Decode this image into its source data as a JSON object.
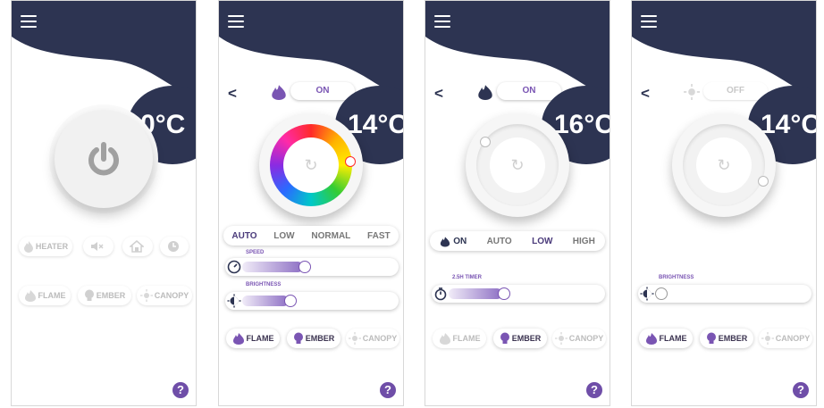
{
  "colors": {
    "navy": "#2d3452",
    "accent": "#7a55b3",
    "muted": "#bcbcbc"
  },
  "screen1": {
    "temperature": "0°C",
    "icons": [
      "heater-icon",
      "mute-icon",
      "home-icon",
      "clock-icon"
    ],
    "heater_label": "HEATER",
    "flame_label": "FLAME",
    "ember_label": "EMBER",
    "canopy_label": "CANOPY"
  },
  "screen2": {
    "temperature": "14°C",
    "toggle": "ON",
    "modes": [
      "AUTO",
      "LOW",
      "NORMAL",
      "FAST"
    ],
    "selected_mode": "AUTO",
    "speed_label": "SPEED",
    "speed_level": 0.5,
    "brightness_label": "BRIGHTNESS",
    "brightness_level": 0.4,
    "flame_label": "FLAME",
    "ember_label": "EMBER",
    "canopy_label": "CANOPY"
  },
  "screen3": {
    "temperature": "16°C",
    "on_label": "ON",
    "toggle": "ON",
    "modes": [
      "AUTO",
      "LOW",
      "HIGH"
    ],
    "selected_mode": "LOW",
    "timer_label": "2.5H TIMER",
    "timer_level": 0.35,
    "flame_label": "FLAME",
    "ember_label": "EMBER",
    "canopy_label": "CANOPY"
  },
  "screen4": {
    "temperature": "14°C",
    "toggle": "OFF",
    "brightness_label": "BRIGHTNESS",
    "brightness_level": 0.0,
    "flame_label": "FLAME",
    "ember_label": "EMBER",
    "canopy_label": "CANOPY"
  },
  "help_label": "?"
}
